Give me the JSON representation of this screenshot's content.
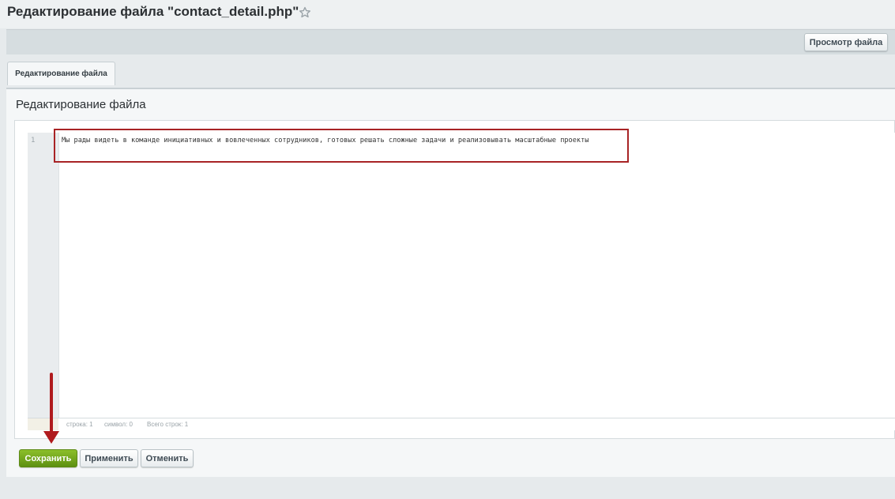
{
  "header": {
    "title": "Редактирование файла \"contact_detail.php\"",
    "favorite_icon": "star-icon"
  },
  "toolbar": {
    "view_file_label": "Просмотр файла"
  },
  "tabs": [
    {
      "label": "Редактирование файла",
      "active": true
    }
  ],
  "section": {
    "title": "Редактирование файла"
  },
  "editor": {
    "line_number": "1",
    "content": "Мы рады видеть в команде инициативных и вовлеченных сотрудников, готовых решать сложные задачи и реализовывать масштабные проекты",
    "status": {
      "line": "строка: 1",
      "char": "символ: 0",
      "total": "Всего строк: 1"
    }
  },
  "actions": {
    "save_label": "Сохранить",
    "apply_label": "Применить",
    "cancel_label": "Отменить"
  },
  "colors": {
    "save_button": "#6ea01a",
    "highlight_border": "#a82325",
    "arrow": "#b01b1e"
  }
}
